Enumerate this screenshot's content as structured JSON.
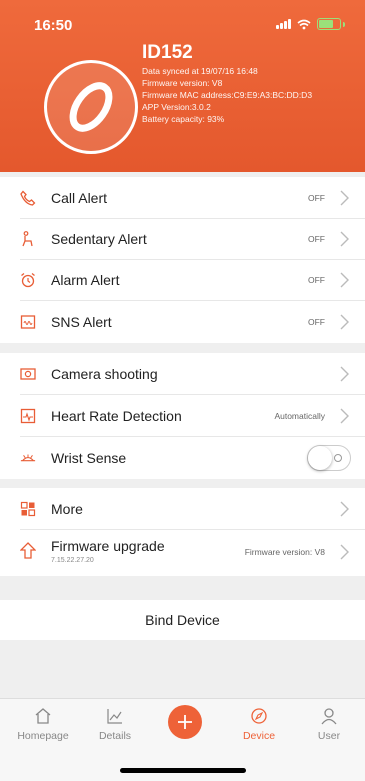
{
  "status_bar": {
    "time": "16:50"
  },
  "device": {
    "name": "ID152",
    "info": [
      "Data synced at 19/07/16 16:48",
      "Firmware version: V8",
      "Firmware MAC address:C9:E9:A3:BC:DD:D3",
      "APP Version:3.0.2",
      "Battery capacity: 93%"
    ]
  },
  "alerts": [
    {
      "label": "Call Alert",
      "value": "OFF"
    },
    {
      "label": "Sedentary Alert",
      "value": "OFF"
    },
    {
      "label": "Alarm Alert",
      "value": "OFF"
    },
    {
      "label": "SNS Alert",
      "value": "OFF"
    }
  ],
  "features": {
    "camera": {
      "label": "Camera shooting"
    },
    "heart_rate": {
      "label": "Heart Rate Detection",
      "value": "Automatically"
    },
    "wrist_sense": {
      "label": "Wrist Sense",
      "enabled": false
    }
  },
  "misc": {
    "more": {
      "label": "More"
    },
    "firmware": {
      "label": "Firmware upgrade",
      "sub": "7.15.22.27.20",
      "value": "Firmware version: V8"
    }
  },
  "bind_device": "Bind Device",
  "tabs": [
    {
      "label": "Homepage",
      "icon": "home-icon",
      "active": false
    },
    {
      "label": "Details",
      "icon": "chart-icon",
      "active": false
    },
    {
      "label": "Device",
      "icon": "compass-icon",
      "active": true
    },
    {
      "label": "User",
      "icon": "user-icon",
      "active": false
    }
  ],
  "colors": {
    "accent": "#ee6238",
    "header": "#e9603a",
    "inactive": "#888888"
  }
}
